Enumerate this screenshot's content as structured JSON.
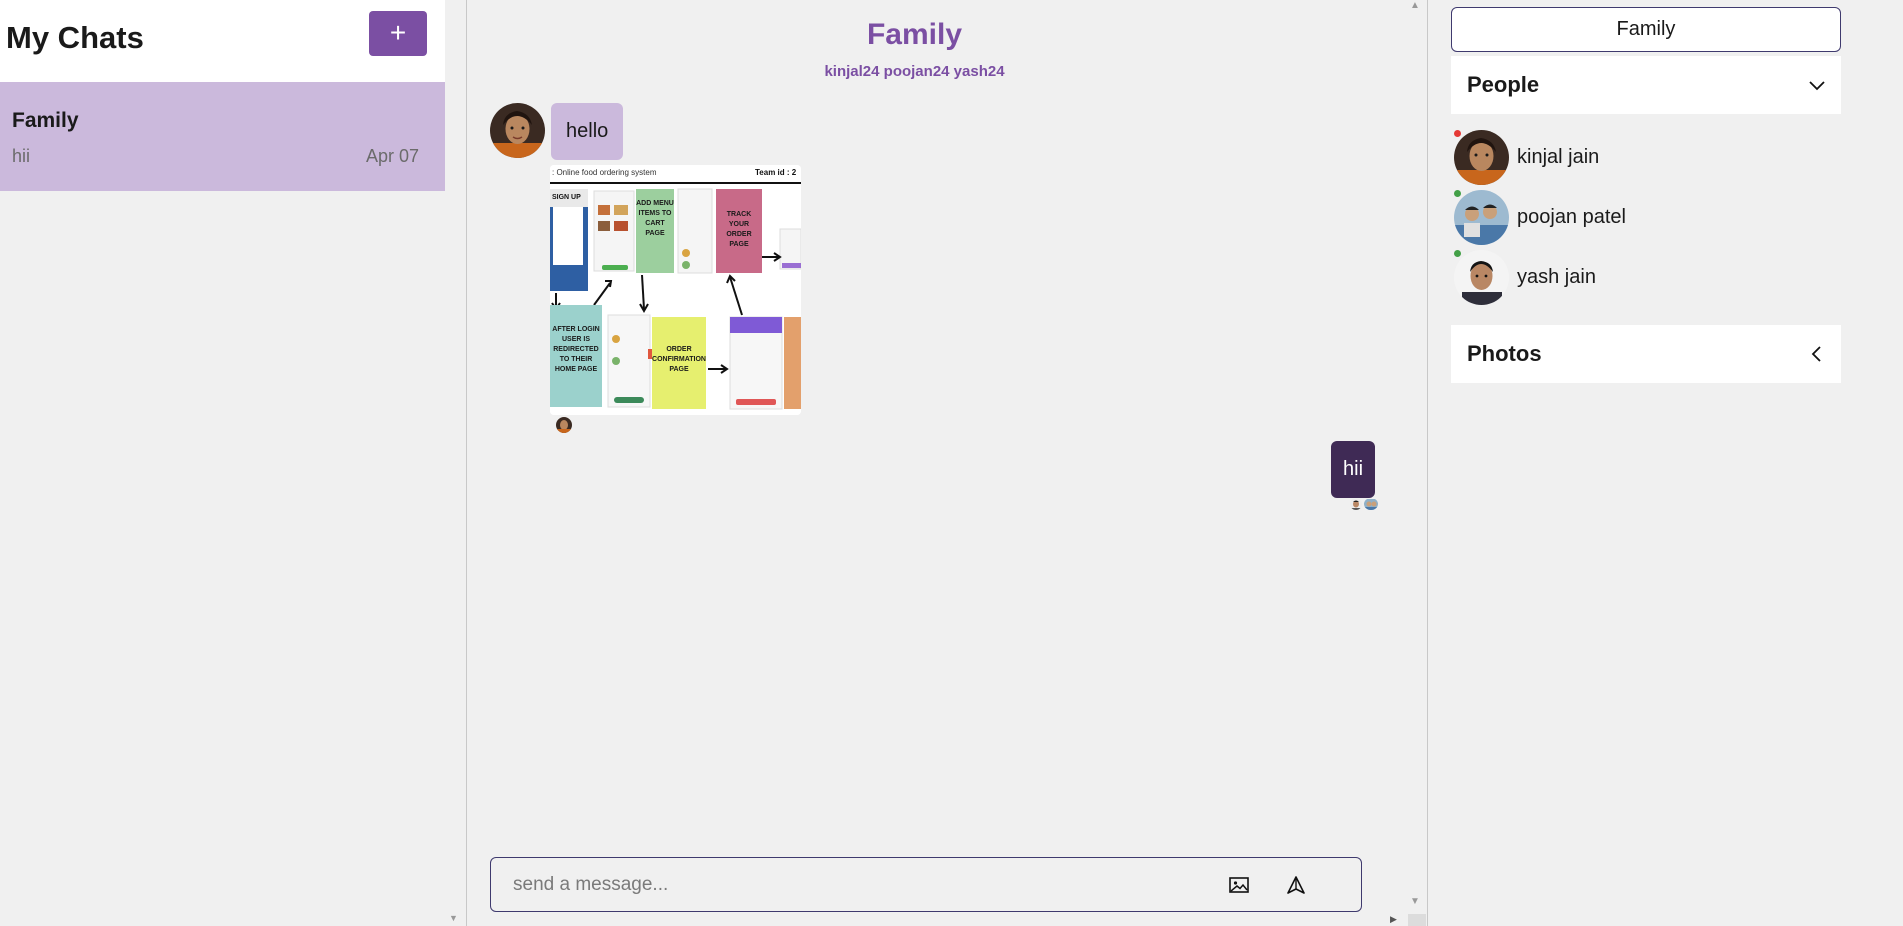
{
  "sidebar": {
    "title": "My Chats",
    "add_label": "+",
    "chats": [
      {
        "name": "Family",
        "last_message": "hii",
        "date": "Apr 07"
      }
    ]
  },
  "conversation": {
    "title": "Family",
    "members": "kinjal24 poojan24 yash24",
    "messages": [
      {
        "type": "text",
        "text": "hello",
        "direction": "incoming"
      },
      {
        "type": "image",
        "direction": "incoming"
      },
      {
        "type": "text",
        "text": "hii",
        "direction": "outgoing"
      }
    ],
    "image_preview": {
      "header_left": ": Online food ordering system",
      "header_right": "Team id : 2",
      "notes": [
        "SIGN UP",
        "ADD MENU ITEMS TO CART PAGE",
        "TRACK YOUR ORDER PAGE",
        "AFTER LOGIN USER IS REDIRECTED TO THEIR HOME PAGE",
        "ORDER CONFIRMATION PAGE"
      ]
    },
    "input": {
      "placeholder": "send a message..."
    }
  },
  "details": {
    "chat_name": "Family",
    "people_label": "People",
    "photos_label": "Photos",
    "people": [
      {
        "name": "kinjal jain",
        "status_color": "#e53935"
      },
      {
        "name": "poojan patel",
        "status_color": "#43a047"
      },
      {
        "name": "yash jain",
        "status_color": "#43a047"
      }
    ]
  },
  "colors": {
    "accent": "#7b4fa3",
    "incoming_bubble": "#cbb9dc",
    "outgoing_bubble": "#3f2a55"
  }
}
